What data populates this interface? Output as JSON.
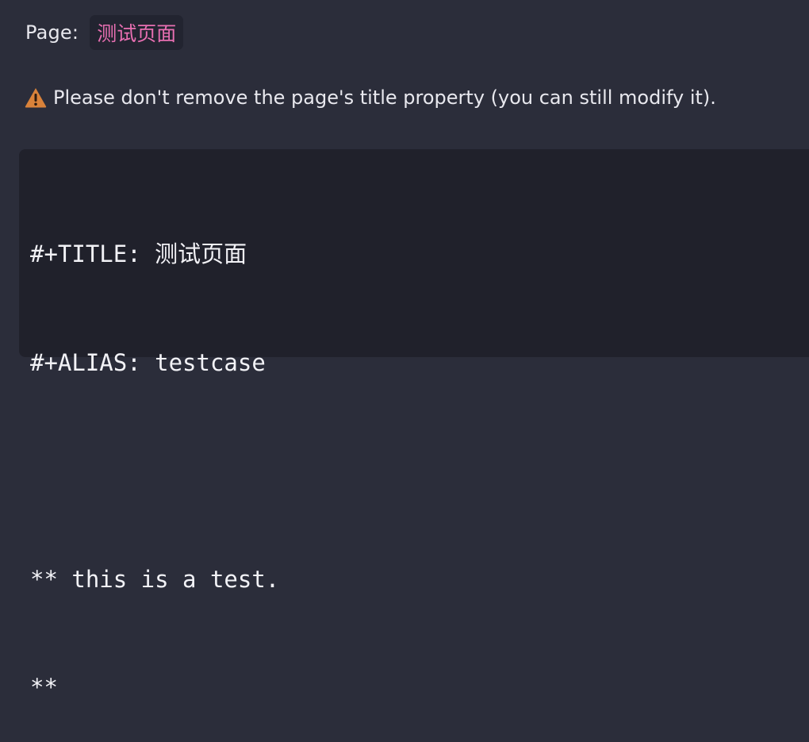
{
  "page": {
    "label": "Page:",
    "title": "测试页面"
  },
  "warning": {
    "icon": "warning-triangle-icon",
    "text": "Please don't remove the page's title property (you can still modify it)."
  },
  "editor": {
    "lines": [
      "#+TITLE: 测试页面",
      "#+ALIAS: testcase",
      "",
      "** this is a test.",
      "**"
    ]
  },
  "colors": {
    "background": "#2b2d3a",
    "code_background": "#20212b",
    "tag_text": "#e86fb2",
    "warning_icon": "#d9823a"
  }
}
